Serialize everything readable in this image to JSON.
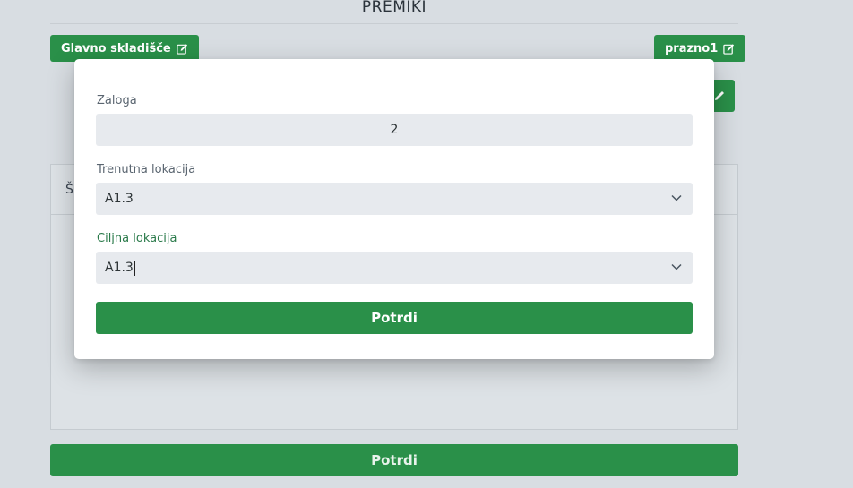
{
  "page": {
    "title": "PREMIKI",
    "source_warehouse_label": "Glavno skladišče",
    "target_warehouse_label": "prazno1",
    "panel_header_fragment": "Š",
    "confirm_label": "Potrdi"
  },
  "modal": {
    "stock_label": "Zaloga",
    "stock_value": "2",
    "current_location_label": "Trenutna lokacija",
    "current_location_value": "A1.3",
    "target_location_label": "Ciljna lokacija",
    "target_location_value": "A1.3",
    "confirm_label": "Potrdi"
  },
  "colors": {
    "accent_green": "#2a9049",
    "backdrop": "#d8dde2",
    "field_bg": "#e7eaee"
  },
  "icons": {
    "edit": "edit-icon",
    "dropdown": "chevron-down-icon"
  }
}
